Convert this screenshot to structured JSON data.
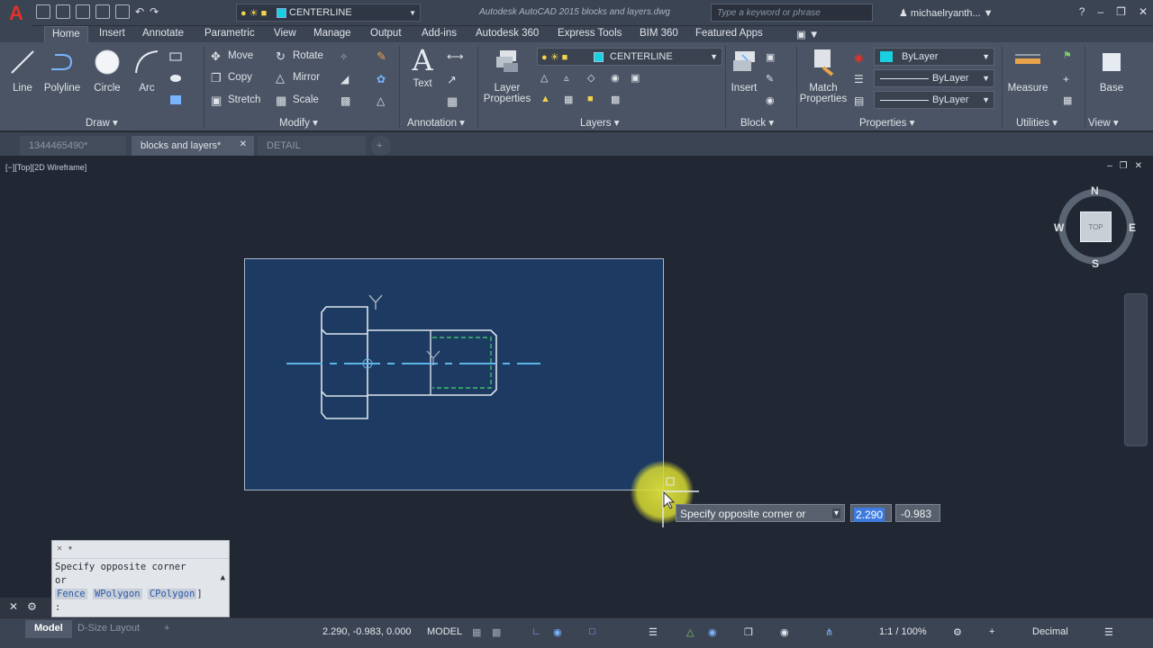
{
  "titlebar": {
    "app_logo": "A",
    "layer_combo": "CENTERLINE",
    "document_title": "Autodesk AutoCAD 2015    blocks and layers.dwg",
    "search_placeholder": "Type a keyword or phrase",
    "user": "michaelryanth..."
  },
  "ribbon": {
    "tabs": [
      "Home",
      "Insert",
      "Annotate",
      "Parametric",
      "View",
      "Manage",
      "Output",
      "Add-ins",
      "Autodesk 360",
      "Express Tools",
      "BIM 360",
      "Featured Apps"
    ],
    "draw": {
      "line": "Line",
      "polyline": "Polyline",
      "circle": "Circle",
      "arc": "Arc",
      "title": "Draw ▾"
    },
    "modify": {
      "move": "Move",
      "rotate": "Rotate",
      "copy": "Copy",
      "mirror": "Mirror",
      "stretch": "Stretch",
      "scale": "Scale",
      "title": "Modify ▾"
    },
    "annotation": {
      "text": "Text",
      "title": "Annotation ▾"
    },
    "layers": {
      "layer_properties_1": "Layer",
      "layer_properties_2": "Properties",
      "current_layer": "CENTERLINE",
      "title": "Layers ▾"
    },
    "block": {
      "insert": "Insert",
      "title": "Block ▾"
    },
    "properties": {
      "match_1": "Match",
      "match_2": "Properties",
      "color": "ByLayer",
      "linetype": "ByLayer",
      "lineweight": "ByLayer",
      "title": "Properties ▾"
    },
    "utilities": {
      "measure": "Measure",
      "title": "Utilities ▾"
    },
    "view": {
      "base": "Base",
      "title": "View ▾"
    },
    "accent_color": "#19d0e0"
  },
  "doc_tabs": [
    "1344465490*",
    "blocks and layers*",
    "DETAIL"
  ],
  "viewport": {
    "label": "[−][Top][2D Wireframe]",
    "compass": {
      "n": "N",
      "s": "S",
      "e": "E",
      "w": "W",
      "cube": "TOP"
    },
    "selection_color": "#1d3a62"
  },
  "dynamic_input": {
    "prompt": "Specify opposite corner or",
    "x_value": "2.290",
    "y_value": "-0.983"
  },
  "command_history": {
    "lines": [
      "Specify opposite corner",
      "or"
    ],
    "options": [
      "Fence",
      "WPolygon",
      "CPolygon"
    ],
    "tail": ":"
  },
  "statusbar": {
    "layout_tabs": [
      "Model",
      "D-Size Layout"
    ],
    "coords": "2.290, -0.983, 0.000",
    "space": "MODEL",
    "scale": "1:1 / 100%",
    "units": "Decimal"
  }
}
